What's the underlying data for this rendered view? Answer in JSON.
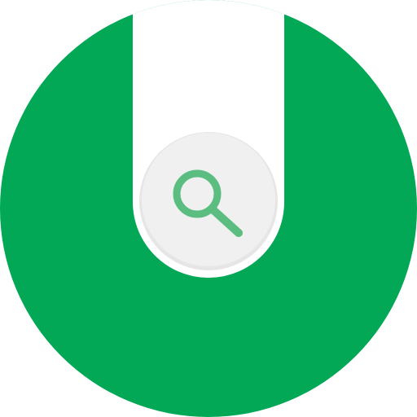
{
  "app_icon": {
    "icon": "magnifier-search-icon",
    "colors": {
      "background_circle": "#02A856",
      "slot_white": "#FFFFFF",
      "button_fill": "#F0F0F0",
      "button_border": "#E3E3E3",
      "search_glyph": "#5BBE80"
    }
  }
}
